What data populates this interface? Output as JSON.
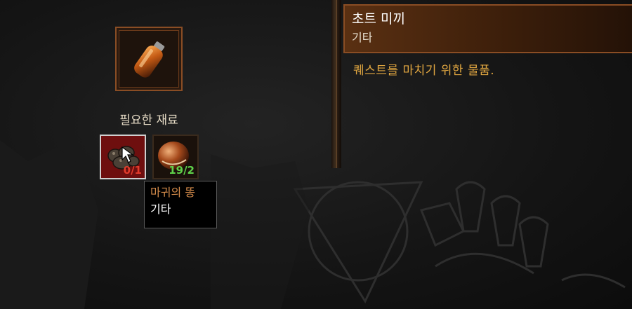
{
  "crafting": {
    "required_label": "필요한 재료",
    "result_item_icon": "bottle-icon",
    "materials": [
      {
        "icon": "demon-dung-icon",
        "count": "0/1",
        "selected": true
      },
      {
        "icon": "chestnut-icon",
        "count": "19/2",
        "selected": false
      }
    ]
  },
  "tooltip": {
    "name": "마귀의 똥",
    "category": "기타"
  },
  "detail": {
    "item_name": "초트 미끼",
    "category": "기타",
    "description": "퀘스트를 마치기 위한 물품."
  },
  "colors": {
    "accent_border": "#8a4d24",
    "description_text": "#e0a640",
    "insufficient_count": "#e23b2b",
    "sufficient_count": "#5fd14a"
  }
}
